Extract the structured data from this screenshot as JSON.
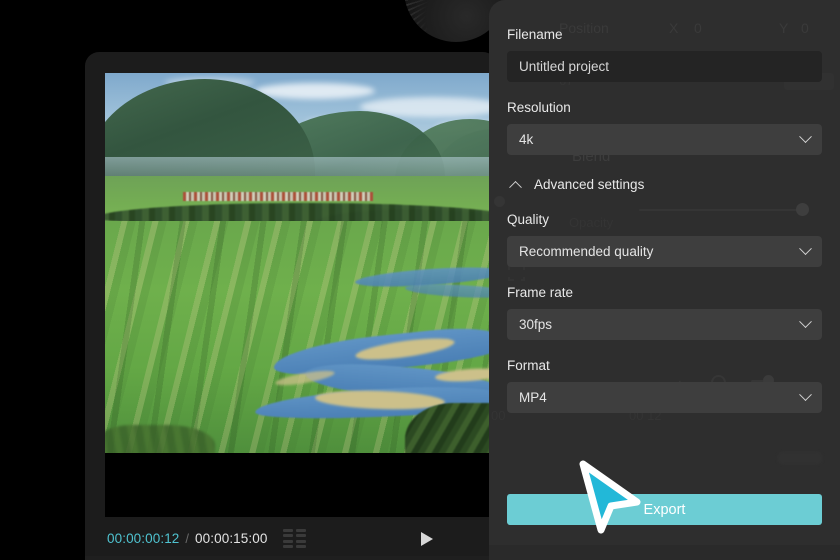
{
  "app": {
    "type": "video-editor-export-panel"
  },
  "preview": {
    "scene_description": "Aerial landscape: green fields, winding river, distant mountains, village",
    "letterbox": true
  },
  "transport": {
    "current_time": "00:00:00:12",
    "separator": "/",
    "total_time": "00:00:15:00",
    "grid_icon_name": "split-view-icon",
    "play_icon_name": "play-icon",
    "current_time_color": "#4fc3d0"
  },
  "export_panel": {
    "filename": {
      "label": "Filename",
      "value": "Untitled project",
      "placeholder": "Untitled project"
    },
    "resolution": {
      "label": "Resolution",
      "value": "4k"
    },
    "advanced_settings": {
      "label": "Advanced settings",
      "expanded": true,
      "chevron_icon_name": "chevron-up-icon"
    },
    "quality": {
      "label": "Quality",
      "value": "Recommended quality"
    },
    "frame_rate": {
      "label": "Frame rate",
      "value": "30fps"
    },
    "format": {
      "label": "Format",
      "value": "MP4"
    },
    "export_button": {
      "label": "Export",
      "color": "#6ccdd4"
    }
  },
  "ghost_layer": {
    "position_label": "Position",
    "x_label": "X",
    "x_value": "0",
    "y_label": "Y",
    "y_value": "0",
    "blend_label": "Blend",
    "opacity_label": "Opacity",
    "timecode_a": "00",
    "timecode_b": "00 12",
    "zoom_value": "67"
  },
  "cursor": {
    "icon_name": "arrow-cursor",
    "fill": "#22b8d8",
    "stroke": "#ffffff"
  }
}
